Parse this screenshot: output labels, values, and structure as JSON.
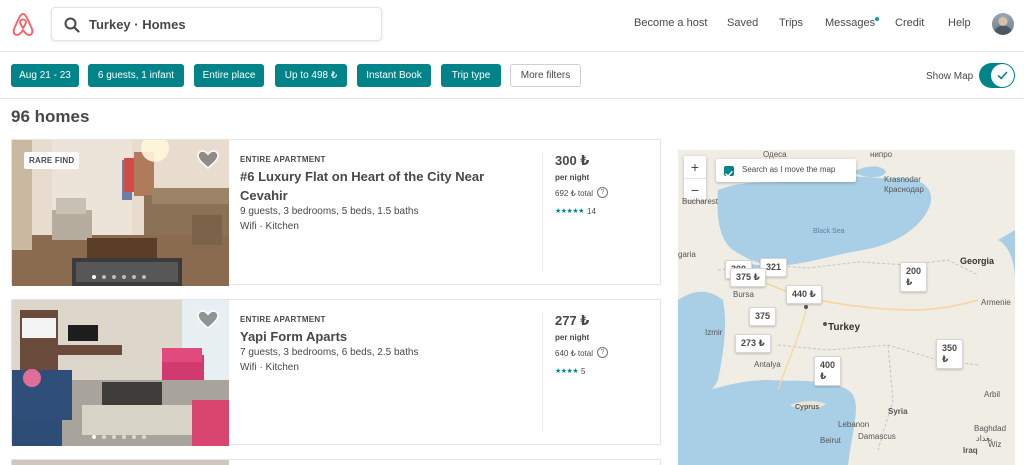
{
  "header": {
    "logo_icon": "airbnb-logo-icon",
    "search": {
      "icon": "search-icon",
      "query": "Turkey · Homes"
    },
    "nav": {
      "become_host": "Become a host",
      "saved": "Saved",
      "trips": "Trips",
      "messages": "Messages",
      "credit": "Credit",
      "help": "Help"
    },
    "messages_unread": true,
    "avatar_icon": "user-avatar"
  },
  "filters": {
    "chips": [
      {
        "label": "Aug 21 - 23",
        "active": true
      },
      {
        "label": "6 guests, 1 infant",
        "active": true
      },
      {
        "label": "Entire place",
        "active": true
      },
      {
        "label": "Up to 498 ₺",
        "active": true
      },
      {
        "label": "Instant Book",
        "active": true
      },
      {
        "label": "Trip type",
        "active": true
      },
      {
        "label": "More filters",
        "active": false
      }
    ],
    "show_map_label": "Show Map",
    "show_map_on": true
  },
  "results": {
    "count_label": "96 homes",
    "listings": [
      {
        "badge": "RARE FIND",
        "type": "ENTIRE APARTMENT",
        "title": "#6 Luxury Flat on Heart of the City Near Cevahir",
        "specs": "9 guests, 3 bedrooms, 5 beds, 1.5 baths",
        "amenities": "Wifi · Kitchen",
        "price": "300 ₺",
        "per_night": "per night",
        "total": "692 ₺ total",
        "stars_glyphs": "★★★★★",
        "rating": 4.5,
        "reviews": "14",
        "photo_index": 1,
        "photo_count": 6
      },
      {
        "badge": "",
        "type": "ENTIRE APARTMENT",
        "title": "Yapi Form Aparts",
        "specs": "7 guests, 3 bedrooms, 6 beds, 2.5 baths",
        "amenities": "Wifi · Kitchen",
        "price": "277 ₺",
        "per_night": "per night",
        "total": "640 ₺ total",
        "stars_glyphs": "★★★★",
        "rating": 4,
        "reviews": "5",
        "photo_index": 1,
        "photo_count": 6
      }
    ]
  },
  "map": {
    "zoom_in": "+",
    "zoom_out": "−",
    "search_as_move_label": "Search as I move the map",
    "search_as_move_checked": true,
    "labels": {
      "odessa": "Одеса",
      "krasnodar_en": "Krasnodar",
      "krasnodar_ru": "Краснодар",
      "bucharest": "Bucharest",
      "black_sea": "Black Sea",
      "bulgaria_part": "garia",
      "georgia": "Georgia",
      "bursa": "Bursa",
      "turkey": "Turkey",
      "izmir": "Izmir",
      "antalya": "Antalya",
      "armenia_part": "Armenie",
      "cyprus": "Cyprus",
      "syria": "Syria",
      "lebanon": "Lebanon",
      "beirut": "Beirut",
      "damascus": "Damascus",
      "baghdad": "Baghdad",
      "baghdad_ar": "بغداد",
      "iraq": "Iraq",
      "arbil": "Arbil",
      "wiz": "Wiz",
      "dnipro_part": "нипро"
    },
    "price_pins": {
      "p375a": "375 ₺",
      "p200": "200",
      "p200b": "₺",
      "p440": "440 ₺",
      "p375b": "375",
      "p375bb": "₺",
      "p273": "273 ₺",
      "p400": "400",
      "p400b": "₺",
      "p350": "350",
      "p350b": "₺",
      "p300": "300",
      "p321": "321"
    }
  }
}
